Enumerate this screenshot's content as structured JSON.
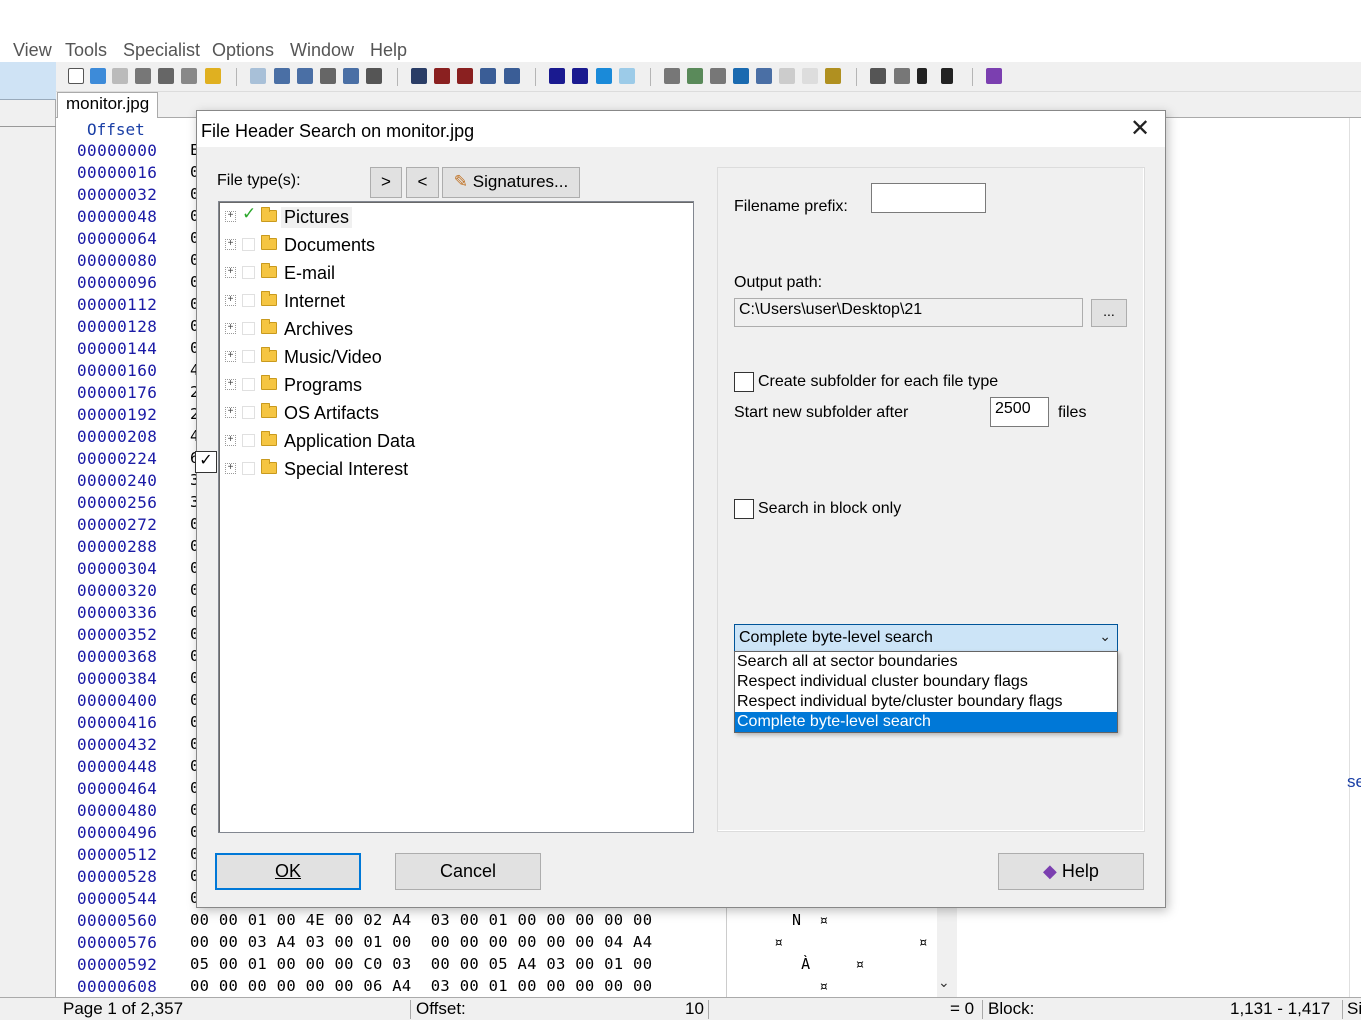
{
  "menu": [
    "View",
    "Tools",
    "Specialist",
    "Options",
    "Window",
    "Help"
  ],
  "tab": {
    "label": "monitor.jpg"
  },
  "hex": {
    "offset_header": "Offset",
    "offsets": [
      "00000000",
      "00000016",
      "00000032",
      "00000048",
      "00000064",
      "00000080",
      "00000096",
      "00000112",
      "00000128",
      "00000144",
      "00000160",
      "00000176",
      "00000192",
      "00000208",
      "00000224",
      "00000240",
      "00000256",
      "00000272",
      "00000288",
      "00000304",
      "00000320",
      "00000336",
      "00000352",
      "00000368",
      "00000384",
      "00000400",
      "00000416",
      "00000432",
      "00000448",
      "00000464",
      "00000480",
      "00000496",
      "00000512",
      "00000528",
      "00000544",
      "00000560",
      "00000576",
      "00000592",
      "00000608"
    ],
    "partial_chars": [
      "E",
      "0",
      "0",
      "0",
      "0",
      "0",
      "0",
      "0",
      "0",
      "0",
      "4",
      "2",
      "2",
      "4",
      "6",
      "3",
      "3",
      "0",
      "0",
      "0",
      "0",
      "0",
      "0",
      "0",
      "0",
      "0",
      "0",
      "0",
      "0",
      "0",
      "0",
      "0",
      "0",
      "0",
      "0"
    ],
    "rows": [
      "00 00 01 00 4E 00 02 A4  03 00 01 00 00 00 00 00",
      "00 00 03 A4 03 00 01 00  00 00 00 00 00 00 04 A4",
      "05 00 01 00 00 00 C0 03  00 00 05 A4 03 00 01 00",
      "00 00 00 00 00 00 06 A4  03 00 01 00 00 00 00 00"
    ],
    "ascii": [
      "  N  ¤",
      "¤               ¤",
      "   À     ¤",
      "     ¤"
    ]
  },
  "right_edge_text": "se",
  "status": {
    "page": "Page 1 of 2,357",
    "offset_label": "Offset:",
    "offset_value": "10",
    "eq": "= 0",
    "block_label": "Block:",
    "block_value": "1,131 - 1,417",
    "size_label": "Si"
  },
  "dialog": {
    "title": "File Header Search on monitor.jpg",
    "filetypes_label": "File type(s):",
    "btn_next": ">",
    "btn_prev": "<",
    "btn_signatures": "Signatures...",
    "tree": [
      {
        "label": "Pictures",
        "checked": true
      },
      {
        "label": "Documents",
        "checked": false
      },
      {
        "label": "E-mail",
        "checked": false
      },
      {
        "label": "Internet",
        "checked": false
      },
      {
        "label": "Archives",
        "checked": false
      },
      {
        "label": "Music/Video",
        "checked": false
      },
      {
        "label": "Programs",
        "checked": false
      },
      {
        "label": "OS Artifacts",
        "checked": false
      },
      {
        "label": "Application Data",
        "checked": false
      },
      {
        "label": "Special Interest",
        "checked": false
      }
    ],
    "filename_prefix_label": "Filename prefix:",
    "filename_prefix_value": "",
    "output_path_label": "Output path:",
    "output_path_value": "C:\\Users\\user\\Desktop\\21",
    "browse_label": "...",
    "create_subfolder_label": "Create subfolder for each file type",
    "start_new_label": "Start new subfolder after",
    "start_new_value": "2500",
    "files_label": "files",
    "search_block_label": "Search in block only",
    "search_mode": {
      "selected": "Complete byte-level search",
      "options": [
        "Search all at sector boundaries",
        "Respect individual cluster boundary flags",
        "Respect individual byte/cluster boundary flags",
        "Complete byte-level search"
      ]
    },
    "ok": "OK",
    "cancel": "Cancel",
    "help": "Help"
  },
  "colors": {
    "accent": "#0078d7",
    "offset_blue": "#1a1aa6",
    "help_icon": "#7b3fb0"
  }
}
